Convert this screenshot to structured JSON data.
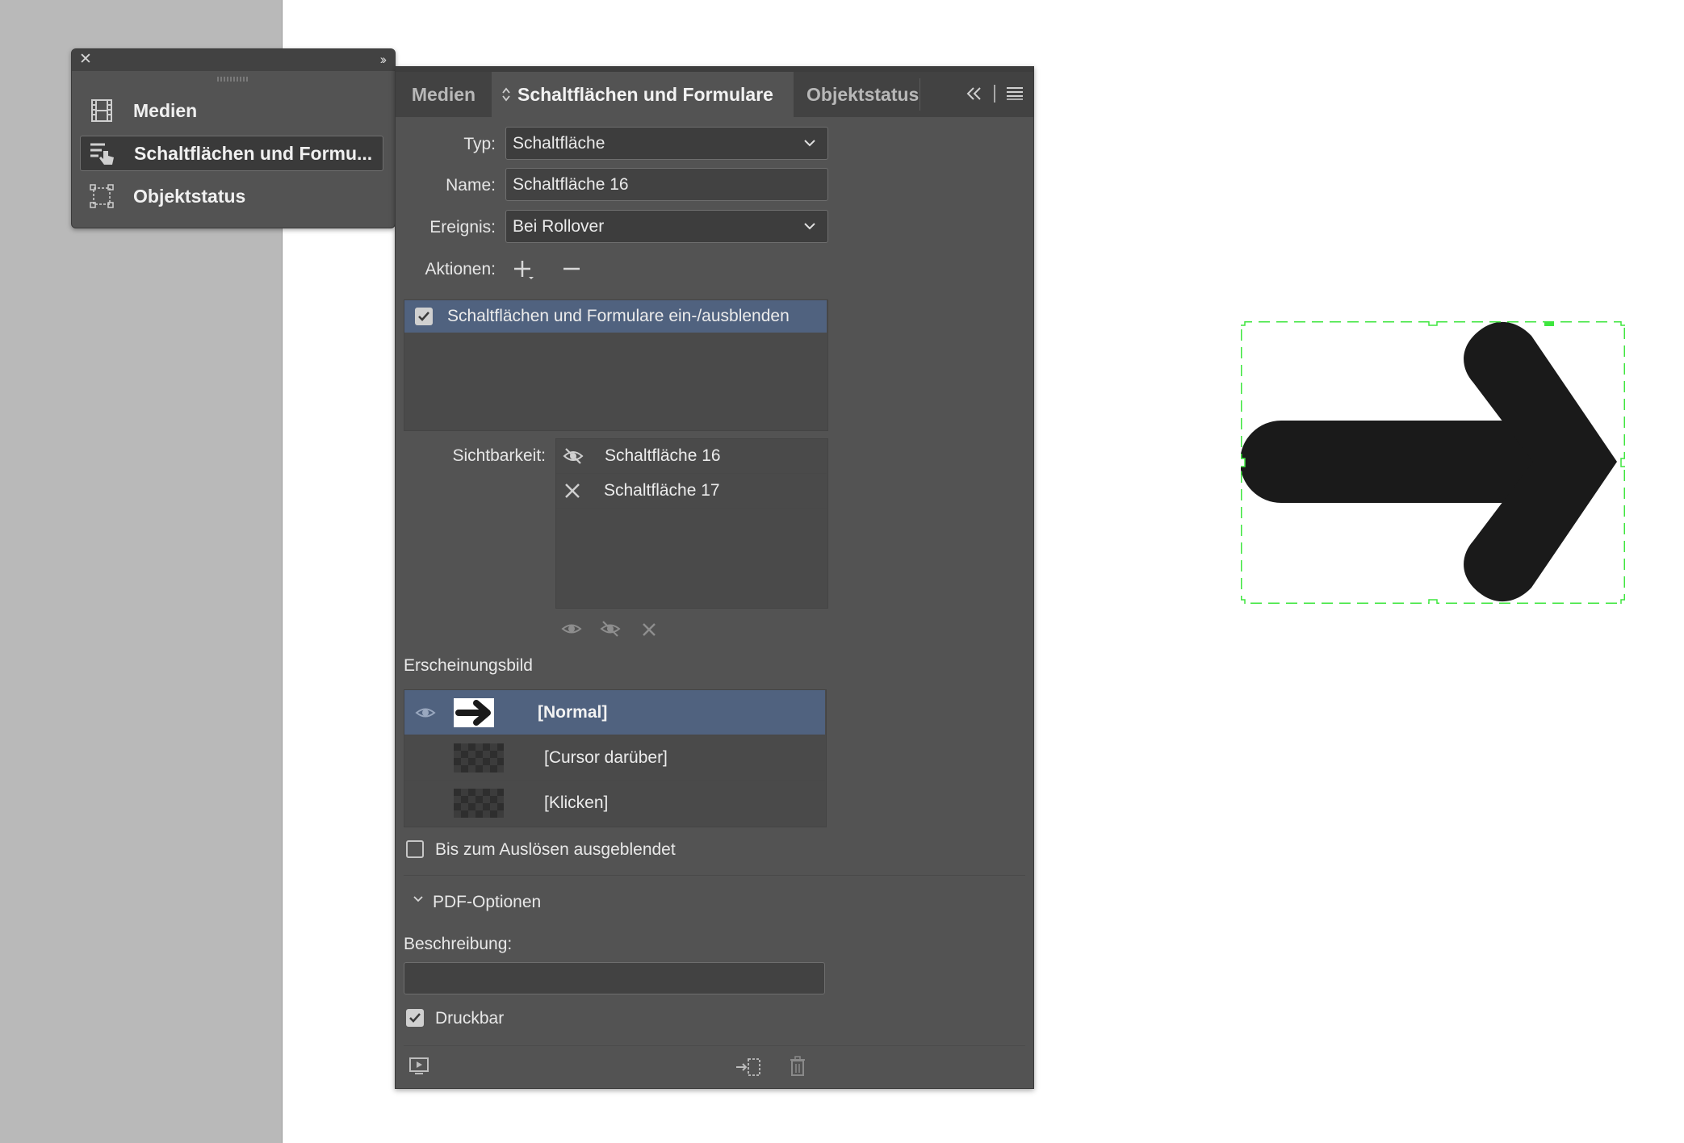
{
  "mini_panel": {
    "items": [
      {
        "label": "Medien",
        "icon": "film-icon"
      },
      {
        "label": "Schaltflächen und Formu...",
        "icon": "button-hand-icon"
      },
      {
        "label": "Objektstatus",
        "icon": "object-state-icon"
      }
    ]
  },
  "tabs": [
    "Medien",
    "Schaltflächen und Formulare",
    "Objektstatus"
  ],
  "form": {
    "type_label": "Typ:",
    "type_value": "Schaltfläche",
    "name_label": "Name:",
    "name_value": "Schaltfläche 16",
    "event_label": "Ereignis:",
    "event_value": "Bei Rollover",
    "actions_label": "Aktionen:"
  },
  "actions": [
    {
      "label": "Schaltflächen und Formulare ein-/ausblenden",
      "checked": true
    }
  ],
  "visibility": {
    "label": "Sichtbarkeit:",
    "items": [
      {
        "name": "Schaltfläche 16",
        "state": "hide-icon"
      },
      {
        "name": "Schaltfläche 17",
        "state": "ignore-icon"
      }
    ]
  },
  "appearance": {
    "heading": "Erscheinungsbild",
    "states": [
      {
        "label": "[Normal]",
        "selected": true
      },
      {
        "label": "[Cursor darüber]",
        "selected": false
      },
      {
        "label": "[Klicken]",
        "selected": false
      }
    ]
  },
  "hidden_until_triggered": {
    "label": "Bis zum Auslösen ausgeblendet",
    "checked": false
  },
  "pdf_options": {
    "heading": "PDF-Optionen",
    "description_label": "Beschreibung:",
    "description_value": "",
    "printable_label": "Druckbar",
    "printable_checked": true
  },
  "colors": {
    "panel_bg": "#535353",
    "selection": "#50627f",
    "frame_selection": "#3ee63e",
    "arrow": "#1a1a1a"
  }
}
